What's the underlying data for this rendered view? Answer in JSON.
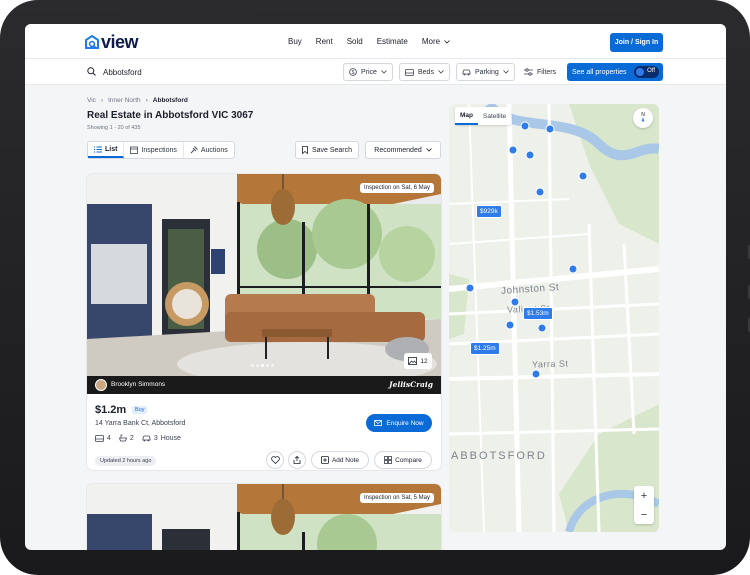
{
  "header": {
    "logo_text": "view",
    "nav": [
      "Buy",
      "Rent",
      "Sold",
      "Estimate",
      "More"
    ],
    "join_label": "Join / Sign In"
  },
  "search": {
    "value": "Abbotsford",
    "filters": [
      "Price",
      "Beds",
      "Parking",
      "Filters"
    ],
    "see_all_label": "See all properties",
    "toggle_label": "Off"
  },
  "breadcrumb": [
    "Vic",
    "Inner North",
    "Abbotsford"
  ],
  "page_title": "Real Estate in Abbotsford VIC 3067",
  "showing": "Showing 1 - 20 of 435",
  "view_tabs": [
    "List",
    "Inspections",
    "Auctions"
  ],
  "save_search_label": "Save Search",
  "sort_label": "Recommended",
  "listing": {
    "inspection": "Inspection on Sat, 6 May",
    "image_count": "12",
    "agent_name": "Brooklyn Simmons",
    "agency": "JellisCraig",
    "price": "$1.2m",
    "badge": "Buy",
    "address": "14 Yarra Bank Ct, Abbotsford",
    "beds": "4",
    "baths": "2",
    "cars": "3",
    "type": "House",
    "updated": "Updated 2 hours ago",
    "enquire_label": "Enquire Now",
    "add_note_label": "Add Note",
    "compare_label": "Compare"
  },
  "listing2": {
    "inspection": "Inspection on Sat, 5 May"
  },
  "map": {
    "tabs": [
      "Map",
      "Satellite"
    ],
    "pins": [
      "$929k",
      "$1.53m",
      "$1.25m"
    ],
    "streets": [
      "Johnston St",
      "Valiant St",
      "Yarra St"
    ],
    "suburb": "ABBOTSFORD",
    "compass": "N"
  }
}
